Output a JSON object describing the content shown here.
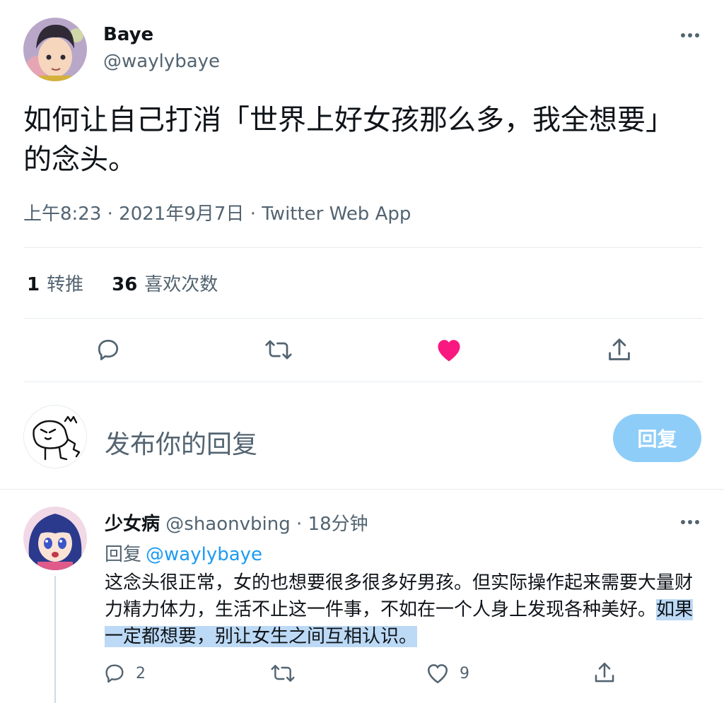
{
  "tweet": {
    "author_name": "Baye",
    "author_handle": "@waylybaye",
    "text": "如何让自己打消「世界上好女孩那么多，我全想要」的念头。",
    "meta": "上午8:23 · 2021年9月7日 · Twitter Web App",
    "retweets_count": "1",
    "retweets_label": "转推",
    "likes_count": "36",
    "likes_label": "喜欢次数",
    "liked": true,
    "like_color": "#f91880"
  },
  "compose": {
    "placeholder": "发布你的回复",
    "button_label": "回复",
    "button_color": "#8ecdf8"
  },
  "reply": {
    "author_name": "少女病",
    "author_handle": "@shaonvbing",
    "time": "· 18分钟",
    "replying_label": "回复",
    "replying_to": "@waylybaye",
    "text_plain": "这念头很正常，女的也想要很多很多好男孩。但实际操作起来需要大量财力精力体力，生活不止这一件事，不如在一个人身上发现各种美好。",
    "text_highlighted": "如果一定都想要，别让女生之间互相认识。",
    "highlight_color": "#bcd9f5",
    "reply_count": "2",
    "like_count": "9"
  },
  "icons": [
    "more-icon",
    "reply-icon",
    "retweet-icon",
    "like-icon",
    "share-icon"
  ],
  "colors": {
    "text_primary": "#0f1419",
    "text_secondary": "#536471",
    "link": "#1d9bf0"
  }
}
